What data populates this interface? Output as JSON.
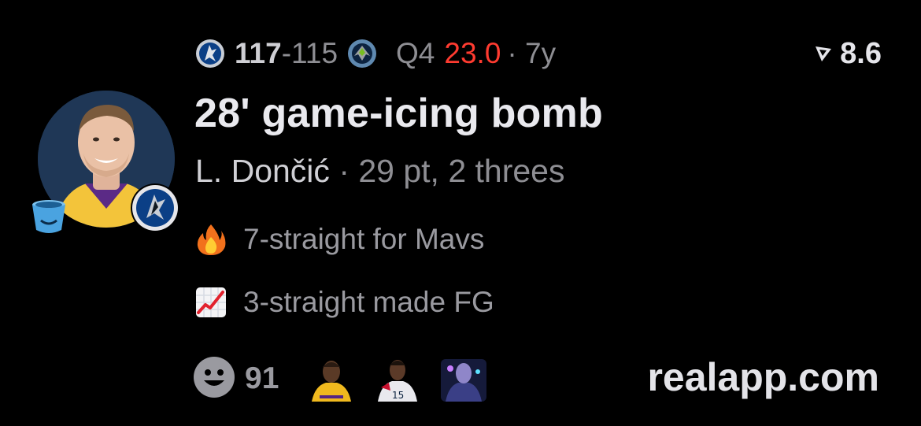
{
  "game": {
    "home_team_logo": "mavericks-logo",
    "home_score": "117",
    "separator": "-",
    "away_score": "115",
    "away_team_logo": "timberwolves-logo",
    "quarter": "Q4",
    "clock": "23.0",
    "age": "· 7y"
  },
  "rating": {
    "icon": "real-rating-icon",
    "value": "8.6"
  },
  "headline": "28' game-icing bomb",
  "player": {
    "name": "L. Dončić",
    "dot": " · ",
    "stats": "29 pt, 2 threes"
  },
  "facts": [
    {
      "icon": "fire-emoji",
      "text": "7-straight for Mavs"
    },
    {
      "icon": "chart-increasing-emoji",
      "text": "3-straight made FG"
    }
  ],
  "footer": {
    "reaction_icon": "smiley-icon",
    "reaction_count": "91",
    "reactor_avatars": [
      "reactor-avatar-1",
      "reactor-avatar-2",
      "reactor-avatar-3"
    ],
    "brand": "realapp.com"
  },
  "colors": {
    "clock_red": "#ff3b30",
    "muted": "#8e8e93",
    "background": "#000000"
  }
}
